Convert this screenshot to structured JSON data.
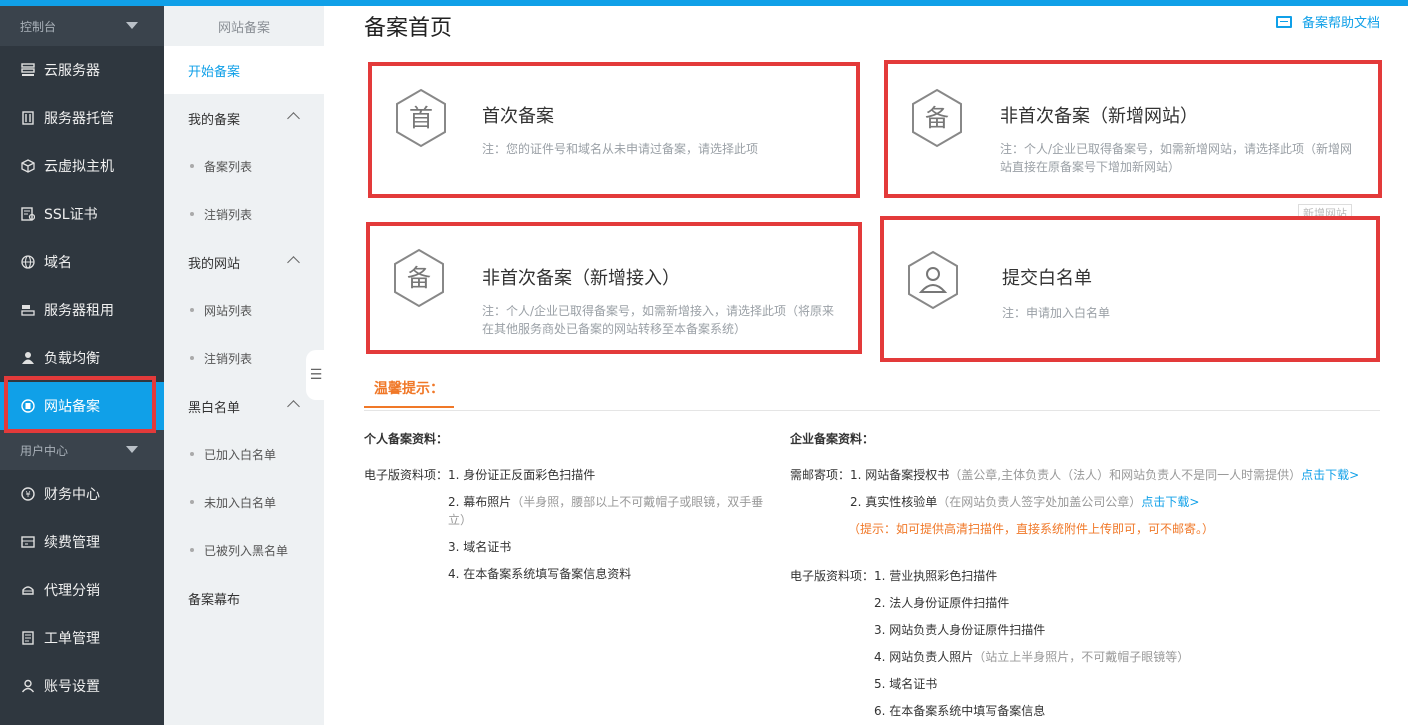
{
  "sidebar": {
    "console_label": "控制台",
    "items": [
      {
        "label": "云服务器",
        "icon": "server-icon"
      },
      {
        "label": "服务器托管",
        "icon": "hosting-icon"
      },
      {
        "label": "云虚拟主机",
        "icon": "cube-icon"
      },
      {
        "label": "SSL证书",
        "icon": "certificate-icon"
      },
      {
        "label": "域名",
        "icon": "globe-icon"
      },
      {
        "label": "服务器租用",
        "icon": "rent-icon"
      },
      {
        "label": "负载均衡",
        "icon": "balance-icon"
      },
      {
        "label": "网站备案",
        "icon": "record-icon"
      }
    ],
    "user_center_label": "用户中心",
    "user_items": [
      {
        "label": "财务中心",
        "icon": "finance-icon"
      },
      {
        "label": "续费管理",
        "icon": "renew-icon"
      },
      {
        "label": "代理分销",
        "icon": "agent-icon"
      },
      {
        "label": "工单管理",
        "icon": "ticket-icon"
      },
      {
        "label": "账号设置",
        "icon": "account-icon"
      }
    ]
  },
  "subnav": {
    "title": "网站备案",
    "start": "开始备案",
    "groups": [
      {
        "label": "我的备案",
        "items": [
          "备案列表",
          "注销列表"
        ]
      },
      {
        "label": "我的网站",
        "items": [
          "网站列表",
          "注销列表"
        ]
      },
      {
        "label": "黑白名单",
        "items": [
          "已加入白名单",
          "未加入白名单",
          "已被列入黑名单"
        ]
      }
    ],
    "curtain": "备案幕布"
  },
  "main": {
    "title": "备案首页",
    "help_link": "备案帮助文档",
    "ghost_tip": "新增网站",
    "cards": [
      {
        "glyph": "首",
        "title": "首次备案",
        "note": "注：您的证件号和域名从未申请过备案，请选择此项"
      },
      {
        "glyph": "备",
        "title": "非首次备案（新增网站）",
        "note": "注：个人/企业已取得备案号，如需新增网站，请选择此项（新增网站直接在原备案号下增加新网站）"
      },
      {
        "glyph": "备",
        "title": "非首次备案（新增接入）",
        "note": "注：个人/企业已取得备案号，如需新增接入，请选择此项（将原来在其他服务商处已备案的网站转移至本备案系统）"
      },
      {
        "glyph": "",
        "title": "提交白名单",
        "note": "注：申请加入白名单"
      }
    ],
    "tip_tab": "温馨提示：",
    "personal": {
      "head": "个人备案资料：",
      "label": "电子版资料项：",
      "items": [
        {
          "num": "1.",
          "text": "身份证正反面彩色扫描件",
          "extra": ""
        },
        {
          "num": "2.",
          "text": "幕布照片",
          "extra": "（半身照，腰部以上不可戴帽子或眼镜，双手垂立）"
        },
        {
          "num": "3.",
          "text": "域名证书",
          "extra": ""
        },
        {
          "num": "4.",
          "text": "在本备案系统填写备案信息资料",
          "extra": ""
        }
      ]
    },
    "company": {
      "head": "企业备案资料：",
      "mail_label": "需邮寄项：",
      "mail_items": [
        {
          "num": "1.",
          "text": "网站备案授权书",
          "extra": "（盖公章,主体负责人（法人）和网站负责人不是同一人时需提供）",
          "link": "点击下载>"
        },
        {
          "num": "2.",
          "text": "真实性核验单",
          "extra": "（在网站负责人签字处加盖公司公章）",
          "link": "点击下载>"
        }
      ],
      "mail_tip": "（提示：如可提供高清扫描件，直接系统附件上传即可，可不邮寄。）",
      "e_label": "电子版资料项：",
      "e_items": [
        {
          "num": "1.",
          "text": "营业执照彩色扫描件",
          "extra": ""
        },
        {
          "num": "2.",
          "text": "法人身份证原件扫描件",
          "extra": ""
        },
        {
          "num": "3.",
          "text": "网站负责人身份证原件扫描件",
          "extra": ""
        },
        {
          "num": "4.",
          "text": "网站负责人照片",
          "extra": "（站立上半身照片，不可戴帽子眼镜等）"
        },
        {
          "num": "5.",
          "text": "域名证书",
          "extra": ""
        },
        {
          "num": "6.",
          "text": "在本备案系统中填写备案信息",
          "extra": ""
        }
      ]
    }
  },
  "colors": {
    "accent": "#10a0e8",
    "highlight": "#e33a3a",
    "warn": "#f07828",
    "sidebar_bg": "#2f373f"
  }
}
